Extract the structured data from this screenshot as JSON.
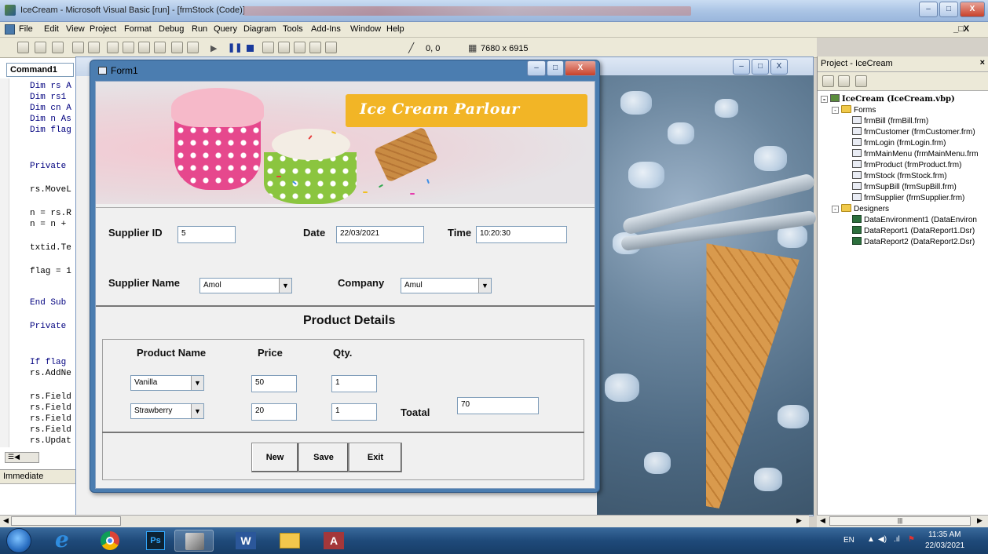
{
  "window": {
    "title": "IceCream - Microsoft Visual Basic [run] - [frmStock (Code)]",
    "controls": [
      "–",
      "□",
      "X"
    ]
  },
  "menu": [
    "File",
    "Edit",
    "View",
    "Project",
    "Format",
    "Debug",
    "Run",
    "Query",
    "Diagram",
    "Tools",
    "Add-Ins",
    "Window",
    "Help"
  ],
  "toolbar": {
    "position": "0, 0",
    "size": "7680 x 6915"
  },
  "code": {
    "object_combo": "Command1",
    "lines": [
      "Dim rs A",
      "Dim rs1",
      "Dim cn A",
      "Dim n As",
      "Dim flag",
      "Private",
      "rs.MoveL",
      "n = rs.R",
      "n = n +",
      "txtid.Te",
      "flag = 1",
      "End Sub",
      "Private",
      "If flag",
      "rs.AddNe",
      "rs.Field",
      "rs.Field",
      "rs.Field",
      "rs.Field",
      "rs.Updat"
    ],
    "immediate_label": "Immediate"
  },
  "project": {
    "header": "Project - IceCream",
    "root": "IceCream (IceCream.vbp)",
    "forms_label": "Forms",
    "forms": [
      "frmBill (frmBill.frm)",
      "frmCustomer (frmCustomer.frm)",
      "frmLogin (frmLogin.frm)",
      "frmMainMenu (frmMainMenu.frm",
      "frmProduct (frmProduct.frm)",
      "frmStock (frmStock.frm)",
      "frmSupBill (frmSupBill.frm)",
      "frmSupplier (frmSupplier.frm)"
    ],
    "designers_label": "Designers",
    "designers": [
      "DataEnvironment1 (DataEnviron",
      "DataReport1 (DataReport1.Dsr)",
      "DataReport2 (DataReport2.Dsr)"
    ]
  },
  "form1": {
    "title": "Form1",
    "banner_text": "Ice Cream Parlour",
    "supplier_id_label": "Supplier ID",
    "supplier_id_value": "5",
    "date_label": "Date",
    "date_value": "22/03/2021",
    "time_label": "Time",
    "time_value": "10:20:30",
    "supplier_name_label": "Supplier Name",
    "supplier_name_value": "Amol",
    "company_label": "Company",
    "company_value": "Amul",
    "section_title": "Product Details",
    "col_product": "Product Name",
    "col_price": "Price",
    "col_qty": "Qty.",
    "rows": [
      {
        "product": "Vanilla",
        "price": "50",
        "qty": "1"
      },
      {
        "product": "Strawberry",
        "price": "20",
        "qty": "1"
      }
    ],
    "total_label": "Toatal",
    "total_value": "70",
    "buttons": {
      "new": "New",
      "save": "Save",
      "exit": "Exit"
    }
  },
  "taskbar": {
    "lang": "EN",
    "time": "11:35 AM",
    "date": "22/03/2021"
  }
}
